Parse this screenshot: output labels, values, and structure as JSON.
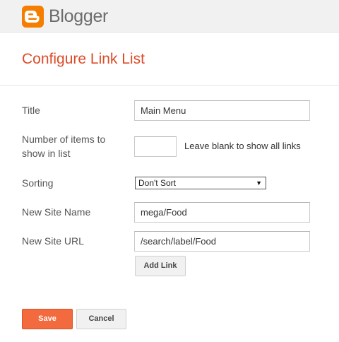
{
  "header": {
    "brand": "Blogger"
  },
  "page": {
    "title": "Configure Link List"
  },
  "form": {
    "title_label": "Title",
    "title_value": "Main Menu",
    "num_items_label_line1": "Number of items to",
    "num_items_label_line2": "show in list",
    "num_items_value": "",
    "num_items_hint": "Leave blank to show all links",
    "sorting_label": "Sorting",
    "sorting_value": "Don't Sort",
    "new_site_name_label": "New Site Name",
    "new_site_name_value": "mega/Food",
    "new_site_url_label": "New Site URL",
    "new_site_url_value": "/search/label/Food",
    "add_link_label": "Add Link"
  },
  "footer": {
    "save_label": "Save",
    "cancel_label": "Cancel"
  },
  "colors": {
    "brand_orange": "#f57d00",
    "title_red": "#dd4b28",
    "save_orange": "#f26a3d"
  }
}
